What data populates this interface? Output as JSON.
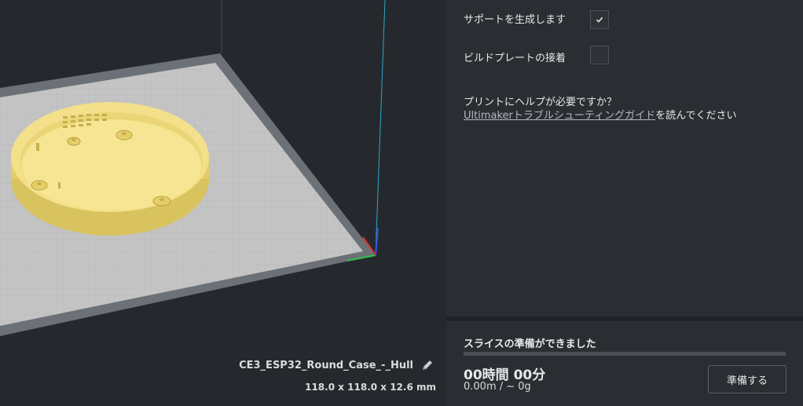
{
  "viewport": {
    "model_name": "CE3_ESP32_Round_Case_-_Hull",
    "model_dimensions": "118.0 x 118.0 x 12.6 mm",
    "icons": {
      "edit": "pencil-icon"
    }
  },
  "settings": {
    "support_label": "サポートを生成します",
    "support_checked": true,
    "adhesion_label": "ビルドプレートの接着",
    "adhesion_checked": false,
    "help_question": "プリントにヘルプが必要ですか？",
    "help_link": "Ultimakerトラブルシューティングガイド",
    "help_suffix": "を読んでください"
  },
  "action_panel": {
    "status": "スライスの準備ができました",
    "progress": 0,
    "print_time": "00時間 00分",
    "material": "0.00m / ~ 0g",
    "prepare_button": "準備する"
  },
  "colors": {
    "accent": "#f4e08a",
    "background": "#1f2226",
    "panel": "#2a2e33"
  }
}
